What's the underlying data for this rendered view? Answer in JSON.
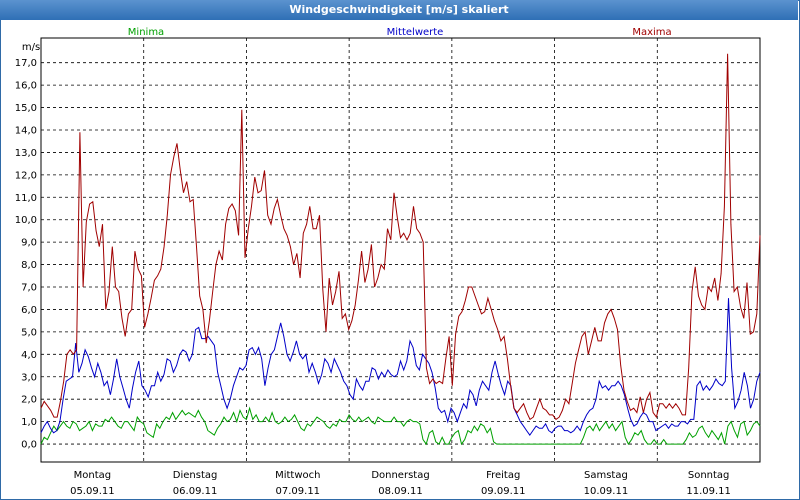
{
  "window": {
    "title": "Windgeschwindigkeit [m/s] skaliert"
  },
  "chart_data": {
    "type": "line",
    "title": "Windgeschwindigkeit [m/s] skaliert",
    "ylabel": "m/s",
    "ylim": [
      -0.8,
      18.1
    ],
    "yticks": [
      "0,0",
      "1,0",
      "2,0",
      "3,0",
      "4,0",
      "5,0",
      "6,0",
      "7,0",
      "8,0",
      "9,0",
      "10,0",
      "11,0",
      "12,0",
      "13,0",
      "14,0",
      "15,0",
      "16,0",
      "17,0"
    ],
    "days": [
      {
        "weekday": "Montag",
        "date": "05.09.11"
      },
      {
        "weekday": "Dienstag",
        "date": "06.09.11"
      },
      {
        "weekday": "Mittwoch",
        "date": "07.09.11"
      },
      {
        "weekday": "Donnerstag",
        "date": "08.09.11"
      },
      {
        "weekday": "Freitag",
        "date": "09.09.11"
      },
      {
        "weekday": "Samstag",
        "date": "10.09.11"
      },
      {
        "weekday": "Sonntag",
        "date": "11.09.11"
      }
    ],
    "grid": true,
    "legend_position": "top",
    "series": [
      {
        "name": "Minima",
        "color": "#00a000",
        "values": [
          0.0,
          0.3,
          0.2,
          0.5,
          0.8,
          0.6,
          0.8,
          1.0,
          0.8,
          0.7,
          1.0,
          0.9,
          0.6,
          0.7,
          0.8,
          1.0,
          0.6,
          0.9,
          0.8,
          0.8,
          1.1,
          1.0,
          1.2,
          1.0,
          0.8,
          0.7,
          1.0,
          1.0,
          0.8,
          0.6,
          1.2,
          1.0,
          0.9,
          0.5,
          0.4,
          0.3,
          0.9,
          0.7,
          1.0,
          1.2,
          1.1,
          1.4,
          1.1,
          1.3,
          1.5,
          1.3,
          1.4,
          1.3,
          1.2,
          1.5,
          1.2,
          1.0,
          0.6,
          0.5,
          0.4,
          0.7,
          0.9,
          1.2,
          1.0,
          1.1,
          1.4,
          1.0,
          1.5,
          1.2,
          1.1,
          1.6,
          1.1,
          1.3,
          1.0,
          1.0,
          1.2,
          1.0,
          1.4,
          1.0,
          0.9,
          1.0,
          1.2,
          1.0,
          1.1,
          1.3,
          1.0,
          0.7,
          0.6,
          0.9,
          0.8,
          1.0,
          1.2,
          1.1,
          1.0,
          0.8,
          0.7,
          0.9,
          0.8,
          1.1,
          1.0,
          1.0,
          1.3,
          1.1,
          1.0,
          1.2,
          1.0,
          1.1,
          1.2,
          1.0,
          0.9,
          1.2,
          1.1,
          1.0,
          1.0,
          1.0,
          1.2,
          1.0,
          1.0,
          0.8,
          1.0,
          1.1,
          1.0,
          1.0,
          0.9,
          0.2,
          0.0,
          0.5,
          0.6,
          0.1,
          0.0,
          0.3,
          0.0,
          0.0,
          0.3,
          0.5,
          0.6,
          0.0,
          0.2,
          0.6,
          0.5,
          0.8,
          0.6,
          0.9,
          0.8,
          0.5,
          0.7,
          0.1,
          0.0,
          0.0,
          0.0,
          0.0,
          0.0,
          0.0,
          0.0,
          0.0,
          0.0,
          0.0,
          0.0,
          0.0,
          0.0,
          0.0,
          0.0,
          0.0,
          0.0,
          0.0,
          0.0,
          0.0,
          0.0,
          0.0,
          0.0,
          0.0,
          0.0,
          0.0,
          0.0,
          0.3,
          0.7,
          0.8,
          0.6,
          0.9,
          0.6,
          0.8,
          1.0,
          0.7,
          0.9,
          0.6,
          0.8,
          1.0,
          0.3,
          0.0,
          0.2,
          0.5,
          0.4,
          0.6,
          0.2,
          0.0,
          0.0,
          0.2,
          0.0,
          0.0,
          0.2,
          0.0,
          0.0,
          0.0,
          0.0,
          0.0,
          0.0,
          0.2,
          0.5,
          0.3,
          0.4,
          0.7,
          0.8,
          0.5,
          0.3,
          0.6,
          0.4,
          0.2,
          0.5,
          0.0,
          0.8,
          1.0,
          0.6,
          0.3,
          0.9,
          1.0,
          0.4,
          0.6,
          0.9,
          1.0,
          0.8
        ]
      },
      {
        "name": "Mittelwerte",
        "color": "#0000c8",
        "values": [
          0.5,
          0.8,
          1.0,
          0.7,
          0.5,
          0.6,
          1.0,
          2.0,
          2.8,
          2.9,
          3.0,
          4.5,
          3.2,
          3.6,
          4.2,
          3.9,
          3.4,
          3.0,
          3.6,
          3.2,
          2.6,
          2.8,
          2.2,
          2.9,
          3.8,
          3.0,
          2.5,
          2.0,
          1.6,
          2.5,
          3.2,
          3.7,
          2.6,
          2.4,
          2.1,
          2.6,
          2.6,
          3.2,
          2.8,
          3.1,
          3.8,
          3.7,
          3.2,
          3.5,
          4.0,
          4.2,
          4.1,
          3.7,
          4.0,
          5.1,
          5.2,
          4.7,
          4.7,
          4.8,
          4.6,
          4.4,
          3.2,
          2.6,
          2.0,
          1.6,
          2.0,
          2.6,
          3.0,
          3.4,
          3.3,
          3.5,
          4.2,
          4.3,
          4.0,
          4.3,
          3.8,
          2.6,
          3.4,
          4.0,
          4.2,
          4.8,
          5.4,
          4.8,
          4.0,
          3.7,
          4.1,
          4.6,
          4.0,
          3.8,
          4.0,
          3.2,
          3.6,
          3.2,
          2.7,
          3.1,
          3.8,
          3.6,
          3.2,
          3.8,
          3.5,
          3.2,
          2.8,
          2.6,
          2.2,
          2.0,
          2.9,
          2.6,
          2.4,
          2.8,
          2.8,
          3.4,
          3.3,
          2.9,
          3.2,
          3.0,
          3.3,
          3.1,
          3.0,
          3.1,
          3.7,
          3.3,
          3.7,
          4.6,
          4.3,
          3.5,
          3.3,
          4.0,
          3.8,
          3.6,
          3.2,
          2.5,
          1.6,
          1.4,
          1.5,
          1.0,
          1.6,
          1.4,
          1.0,
          1.4,
          1.8,
          1.6,
          2.4,
          2.2,
          1.7,
          2.4,
          2.8,
          2.6,
          2.4,
          3.2,
          3.7,
          3.1,
          2.6,
          2.2,
          2.8,
          2.6,
          1.6,
          1.3,
          1.0,
          0.8,
          0.6,
          0.4,
          0.6,
          0.8,
          0.7,
          0.7,
          0.9,
          0.6,
          0.5,
          0.7,
          0.8,
          0.8,
          0.6,
          0.6,
          0.5,
          0.6,
          0.8,
          0.6,
          1.0,
          1.3,
          1.5,
          1.6,
          2.0,
          2.8,
          2.5,
          2.6,
          2.4,
          2.6,
          2.6,
          2.8,
          2.6,
          2.2,
          1.6,
          1.1,
          0.8,
          0.9,
          1.2,
          1.4,
          1.3,
          1.0,
          1.0,
          0.6,
          0.7,
          0.8,
          0.9,
          0.7,
          0.9,
          0.8,
          0.8,
          1.0,
          1.0,
          0.9,
          1.1,
          1.1,
          2.6,
          2.8,
          2.4,
          2.6,
          2.4,
          2.6,
          2.9,
          2.7,
          2.6,
          2.8,
          6.5,
          3.4,
          1.6,
          1.9,
          2.4,
          3.2,
          2.6,
          1.6,
          2.0,
          2.8,
          3.2
        ]
      },
      {
        "name": "Maxima",
        "color": "#a00000",
        "values": [
          1.6,
          1.9,
          1.7,
          1.5,
          1.2,
          1.2,
          1.9,
          2.8,
          4.0,
          4.2,
          4.0,
          4.2,
          13.9,
          7.0,
          9.9,
          10.7,
          10.8,
          9.5,
          8.8,
          9.8,
          6.0,
          6.8,
          8.8,
          7.0,
          6.8,
          5.6,
          4.8,
          5.8,
          6.0,
          8.6,
          7.8,
          7.5,
          5.2,
          5.8,
          6.5,
          7.3,
          7.5,
          7.8,
          8.8,
          10.2,
          12.0,
          12.8,
          13.4,
          12.2,
          11.2,
          11.7,
          10.8,
          10.9,
          8.8,
          6.6,
          6.0,
          4.5,
          5.5,
          6.8,
          8.0,
          8.6,
          8.2,
          9.8,
          10.5,
          10.7,
          10.4,
          9.3,
          14.9,
          8.3,
          9.6,
          10.6,
          11.9,
          11.2,
          11.3,
          12.2,
          10.2,
          9.8,
          10.5,
          10.9,
          10.2,
          9.6,
          9.3,
          8.8,
          8.0,
          8.5,
          7.4,
          9.4,
          9.8,
          10.6,
          9.6,
          9.6,
          10.2,
          6.9,
          5.0,
          7.4,
          6.2,
          6.8,
          7.7,
          5.6,
          5.8,
          5.1,
          5.5,
          6.2,
          7.3,
          8.6,
          7.2,
          7.8,
          8.9,
          7.0,
          7.4,
          8.0,
          7.8,
          9.6,
          9.1,
          11.2,
          10.1,
          9.2,
          9.4,
          9.1,
          9.4,
          10.6,
          9.6,
          9.4,
          9.0,
          3.4,
          2.7,
          2.9,
          2.7,
          2.8,
          2.7,
          3.8,
          4.8,
          2.6,
          4.9,
          5.7,
          5.9,
          6.4,
          7.0,
          7.0,
          6.6,
          6.2,
          5.8,
          5.9,
          6.5,
          6.0,
          5.5,
          5.1,
          4.6,
          4.8,
          3.8,
          2.6,
          1.6,
          1.4,
          1.6,
          1.8,
          1.4,
          1.1,
          1.2,
          1.6,
          2.0,
          1.6,
          1.5,
          1.3,
          1.3,
          1.1,
          1.2,
          1.5,
          2.0,
          1.8,
          2.7,
          3.6,
          4.2,
          4.8,
          5.0,
          4.0,
          4.6,
          5.2,
          4.6,
          4.6,
          5.4,
          5.8,
          6.0,
          5.6,
          5.1,
          3.5,
          2.4,
          1.9,
          1.5,
          1.6,
          1.4,
          2.1,
          1.4,
          2.0,
          2.3,
          1.4,
          1.2,
          1.8,
          1.8,
          1.6,
          1.8,
          1.6,
          1.8,
          1.6,
          1.3,
          1.3,
          3.4,
          6.8,
          7.9,
          6.6,
          6.2,
          6.0,
          7.0,
          6.8,
          7.4,
          6.4,
          7.6,
          10.6,
          17.4,
          9.8,
          6.8,
          7.0,
          6.1,
          5.6,
          7.2,
          4.9,
          5.0,
          5.8,
          9.3
        ]
      }
    ]
  }
}
